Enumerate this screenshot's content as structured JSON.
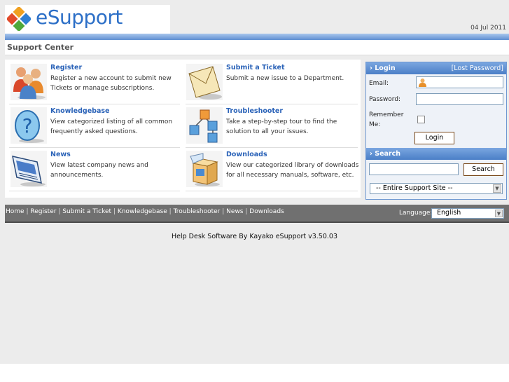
{
  "brand": {
    "logo_text": "eSupport"
  },
  "header": {
    "date": "04 Jul 2011",
    "section_title": "Support Center"
  },
  "modules": [
    {
      "title": "Register",
      "desc": "Register a new account to submit new Tickets or manage subscriptions.",
      "icon": "users-icon"
    },
    {
      "title": "Submit a Ticket",
      "desc": "Submit a new issue to a Department.",
      "icon": "envelope-icon"
    },
    {
      "title": "Knowledgebase",
      "desc": "View categorized listing of all common frequently asked questions.",
      "icon": "question-icon"
    },
    {
      "title": "Troubleshooter",
      "desc": "Take a step-by-step tour to find the solution to all your issues.",
      "icon": "cubes-icon"
    },
    {
      "title": "News",
      "desc": "View latest company news and announcements.",
      "icon": "newspaper-icon"
    },
    {
      "title": "Downloads",
      "desc": "View our categorized library of downloads for all necessary manuals, software, etc.",
      "icon": "box-icon"
    }
  ],
  "login": {
    "heading": "Login",
    "lost_password": "[Lost Password]",
    "email_label": "Email:",
    "email_value": "",
    "password_label": "Password:",
    "remember_label": "Remember Me:",
    "button": "Login"
  },
  "search": {
    "heading": "Search",
    "query": "",
    "button": "Search",
    "scope_selected": "-- Entire Support Site --"
  },
  "nav": {
    "links": [
      "Home",
      "Register",
      "Submit a Ticket",
      "Knowledgebase",
      "Troubleshooter",
      "News",
      "Downloads"
    ],
    "language_label": "Language:",
    "language_selected": "English"
  },
  "footer": {
    "text": "Help Desk Software By Kayako eSupport v3.50.03"
  },
  "colors": {
    "accent": "#2b63b8",
    "nav_bar": "#707070",
    "sidebar_header": "#4b7fc7"
  }
}
